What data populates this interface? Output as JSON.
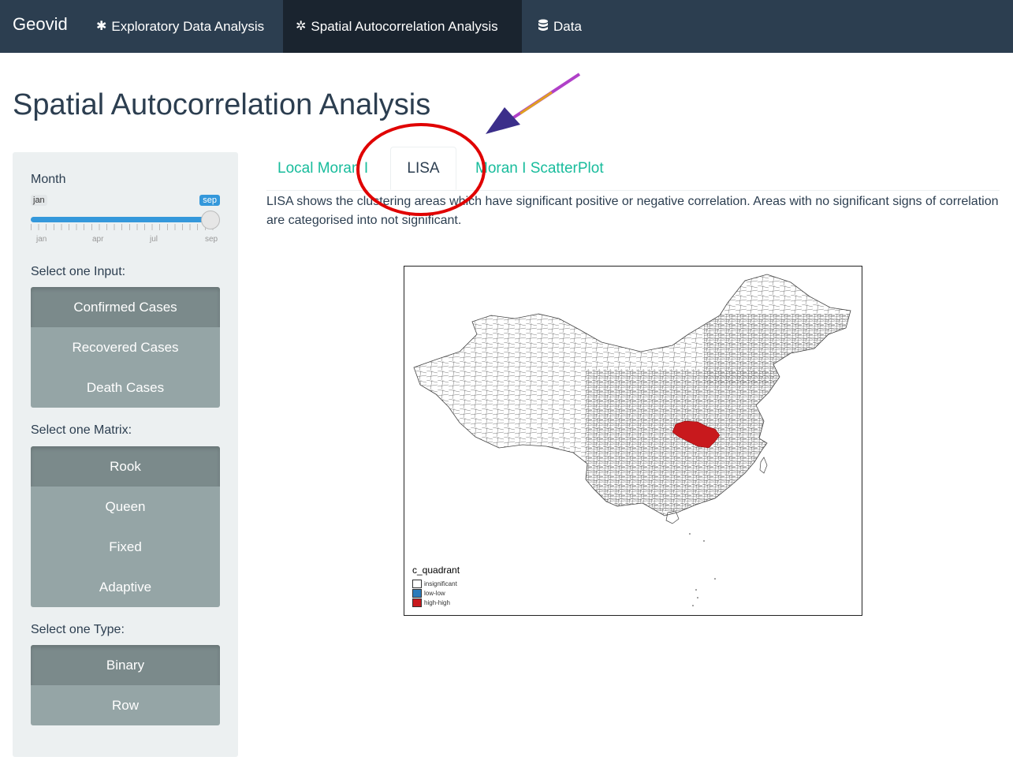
{
  "navbar": {
    "brand": "Geovid",
    "items": [
      {
        "label": "Exploratory Data Analysis",
        "icon": "gear-icon"
      },
      {
        "label": "Spatial Autocorrelation Analysis",
        "icon": "gears-icon"
      },
      {
        "label": "Data",
        "icon": "database-icon"
      }
    ],
    "active_index": 1
  },
  "page_title": "Spatial Autocorrelation Analysis",
  "sidebar": {
    "month_label": "Month",
    "slider": {
      "min_label": "jan",
      "max_label": "sep",
      "tick_labels": [
        "jan",
        "apr",
        "jul",
        "sep"
      ],
      "selected_range": [
        "jan",
        "sep"
      ]
    },
    "input_label": "Select one Input:",
    "inputs": [
      "Confirmed Cases",
      "Recovered Cases",
      "Death Cases"
    ],
    "input_selected": "Confirmed Cases",
    "matrix_label": "Select one Matrix:",
    "matrices": [
      "Rook",
      "Queen",
      "Fixed",
      "Adaptive"
    ],
    "matrix_selected": "Rook",
    "type_label": "Select one Type:",
    "types": [
      "Binary",
      "Row"
    ],
    "type_selected": "Binary"
  },
  "tabs": [
    {
      "label": "Local Moran I"
    },
    {
      "label": "LISA"
    },
    {
      "label": "Moran I ScatterPlot"
    }
  ],
  "active_tab": "LISA",
  "description": "LISA shows the clustering areas which have significant positive or negative correlation. Areas with no significant signs of correlation are categorised into not significant.",
  "map": {
    "legend_title": "c_quadrant",
    "legend": [
      {
        "label": "insignificant",
        "color": "#ffffff"
      },
      {
        "label": "low-low",
        "color": "#2b7bba"
      },
      {
        "label": "high-high",
        "color": "#c8191d"
      }
    ]
  },
  "colors": {
    "navbar": "#2c3e50",
    "navbar_active": "#1a242f",
    "accent_teal": "#18bc9c",
    "slider_blue": "#3498db",
    "button": "#95a5a6",
    "annotation_red": "#e00000"
  }
}
